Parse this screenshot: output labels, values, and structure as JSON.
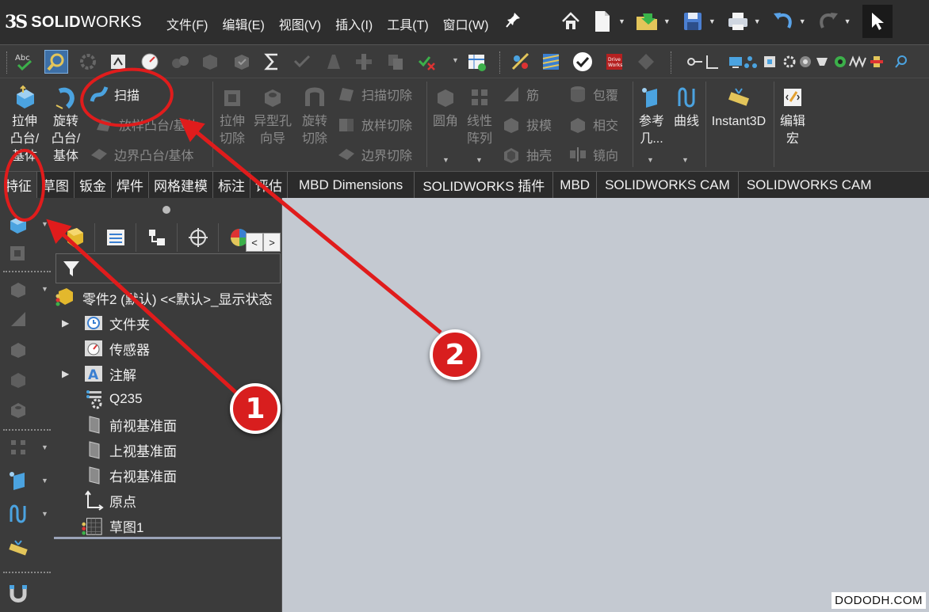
{
  "app": {
    "logo_prefix": "3S",
    "logo_bold": "SOLID",
    "logo_light": "WORKS"
  },
  "menu": [
    "文件(F)",
    "编辑(E)",
    "视图(V)",
    "插入(I)",
    "工具(T)",
    "窗口(W)"
  ],
  "ribbon": {
    "extrude_boss": "拉伸\n凸台/\n基体",
    "revolve_boss": "旋转\n凸台/\n基体",
    "sweep": "扫描",
    "loft_boss": "放样凸台/基体",
    "boundary_boss": "边界凸台/基体",
    "extrude_cut": "拉伸\n切除",
    "hole_wizard": "异型孔\n向导",
    "revolve_cut": "旋转\n切除",
    "sweep_cut": "扫描切除",
    "loft_cut": "放样切除",
    "boundary_cut": "边界切除",
    "fillet": "圆角",
    "linear_pattern": "线性\n阵列",
    "rib": "筋",
    "draft": "拔模",
    "shell": "抽壳",
    "wrap": "包覆",
    "intersect": "相交",
    "mirror": "镜向",
    "reference_geometry": "参考\n几...",
    "curves": "曲线",
    "instant3d": "Instant3D",
    "edit_macro": "编辑\n宏"
  },
  "tabs": [
    "特征",
    "草图",
    "钣金",
    "焊件",
    "网格建模",
    "标注",
    "评估",
    "MBD Dimensions",
    "SOLIDWORKS 插件",
    "MBD",
    "SOLIDWORKS CAM",
    "SOLIDWORKS CAM"
  ],
  "feature_tree": {
    "root": "零件2 (默认) <<默认>_显示状态",
    "items": [
      {
        "label": "文件夹",
        "expandable": true,
        "icon": "history-folder-icon"
      },
      {
        "label": "传感器",
        "expandable": false,
        "icon": "sensor-gauge-icon"
      },
      {
        "label": "注解",
        "expandable": true,
        "icon": "annotation-icon"
      },
      {
        "label": "Q235",
        "expandable": false,
        "icon": "material-icon"
      },
      {
        "label": "前视基准面",
        "expandable": false,
        "icon": "plane-icon"
      },
      {
        "label": "上视基准面",
        "expandable": false,
        "icon": "plane-icon"
      },
      {
        "label": "右视基准面",
        "expandable": false,
        "icon": "plane-icon"
      },
      {
        "label": "原点",
        "expandable": false,
        "icon": "origin-icon"
      },
      {
        "label": "草图1",
        "expandable": false,
        "icon": "sketch-icon"
      }
    ]
  },
  "annotations": {
    "badge1": "1",
    "badge2": "2"
  },
  "watermark": "DODODH.COM",
  "colors": {
    "accent_red": "#d81e1e",
    "ui_dark": "#3b3b3b",
    "canvas": "#c4c9d1",
    "icon_blue": "#4ba3e0"
  }
}
